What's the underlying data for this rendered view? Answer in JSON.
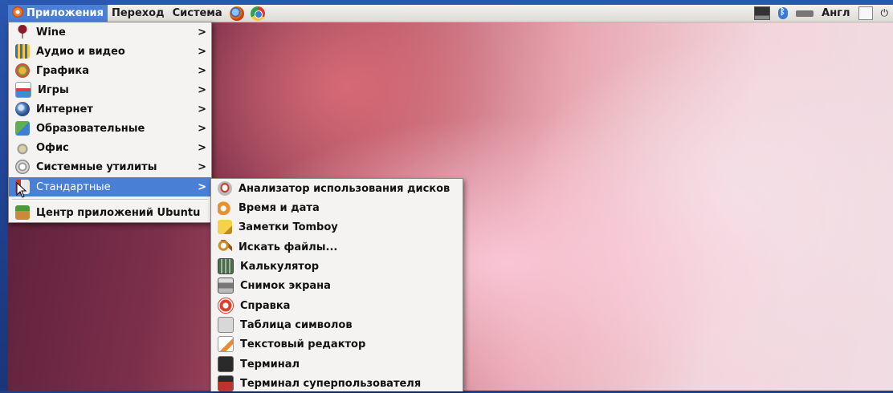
{
  "top_panel": {
    "menus": [
      {
        "label": "Приложения",
        "active": true
      },
      {
        "label": "Переход",
        "active": false
      },
      {
        "label": "Система",
        "active": false
      }
    ],
    "launchers": [
      "firefox-icon",
      "chrome-icon"
    ],
    "tray": {
      "keyboard_layout": "Англ"
    }
  },
  "apps_menu": {
    "items": [
      {
        "label": "Wine",
        "icon": "wine-icon",
        "submenu": true
      },
      {
        "label": "Аудио и видео",
        "icon": "audio-video-icon",
        "submenu": true
      },
      {
        "label": "Графика",
        "icon": "graphics-icon",
        "submenu": true
      },
      {
        "label": "Игры",
        "icon": "games-icon",
        "submenu": true
      },
      {
        "label": "Интернет",
        "icon": "internet-icon",
        "submenu": true
      },
      {
        "label": "Образовательные",
        "icon": "education-icon",
        "submenu": true
      },
      {
        "label": "Офис",
        "icon": "office-icon",
        "submenu": true
      },
      {
        "label": "Системные утилиты",
        "icon": "system-tools-icon",
        "submenu": true
      },
      {
        "label": "Стандартные",
        "icon": "accessories-icon",
        "submenu": true,
        "active": true
      }
    ],
    "footer_item": {
      "label": "Центр приложений Ubuntu",
      "icon": "ubuntu-software-center-icon"
    }
  },
  "accessories_menu": {
    "items": [
      {
        "label": "Анализатор использования дисков",
        "icon": "disk-usage-icon"
      },
      {
        "label": "Время и дата",
        "icon": "clock-icon"
      },
      {
        "label": "Заметки Tomboy",
        "icon": "tomboy-notes-icon"
      },
      {
        "label": "Искать файлы...",
        "icon": "search-files-icon"
      },
      {
        "label": "Калькулятор",
        "icon": "calculator-icon"
      },
      {
        "label": "Снимок экрана",
        "icon": "screenshot-icon"
      },
      {
        "label": "Справка",
        "icon": "help-icon"
      },
      {
        "label": "Таблица символов",
        "icon": "character-map-icon"
      },
      {
        "label": "Текстовый редактор",
        "icon": "text-editor-icon"
      },
      {
        "label": "Терминал",
        "icon": "terminal-icon"
      },
      {
        "label": "Терминал суперпользователя",
        "icon": "root-terminal-icon"
      }
    ]
  },
  "colors": {
    "selection": "#4a7fd6",
    "menu_bg": "#f4f3f1",
    "frame": "#1f3f86"
  }
}
